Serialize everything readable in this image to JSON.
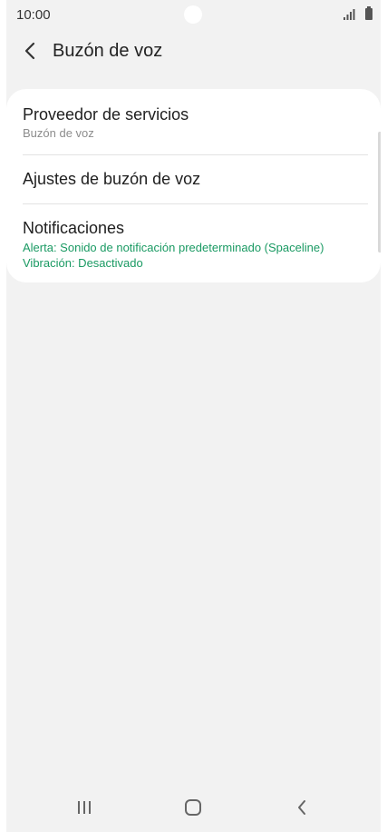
{
  "status_bar": {
    "time": "10:00"
  },
  "header": {
    "title": "Buzón de voz",
    "back_icon": "chevron-left-icon"
  },
  "settings": {
    "items": [
      {
        "title": "Proveedor de servicios",
        "subtitles": [
          "Buzón de voz"
        ],
        "subtitle_color": "#8c8c8c"
      },
      {
        "title": "Ajustes de buzón de voz",
        "subtitles": []
      },
      {
        "title": "Notificaciones",
        "subtitles": [
          "Alerta: Sonido de notificación predeterminado (Spaceline)",
          "Vibración: Desactivado"
        ],
        "subtitle_color": "#1a9a63"
      }
    ]
  },
  "nav_bar": {
    "icons": [
      "recent-apps-icon",
      "home-icon",
      "back-icon"
    ]
  },
  "colors": {
    "background": "#f2f2f2",
    "card": "#ffffff",
    "accent_green": "#1a9a63"
  }
}
